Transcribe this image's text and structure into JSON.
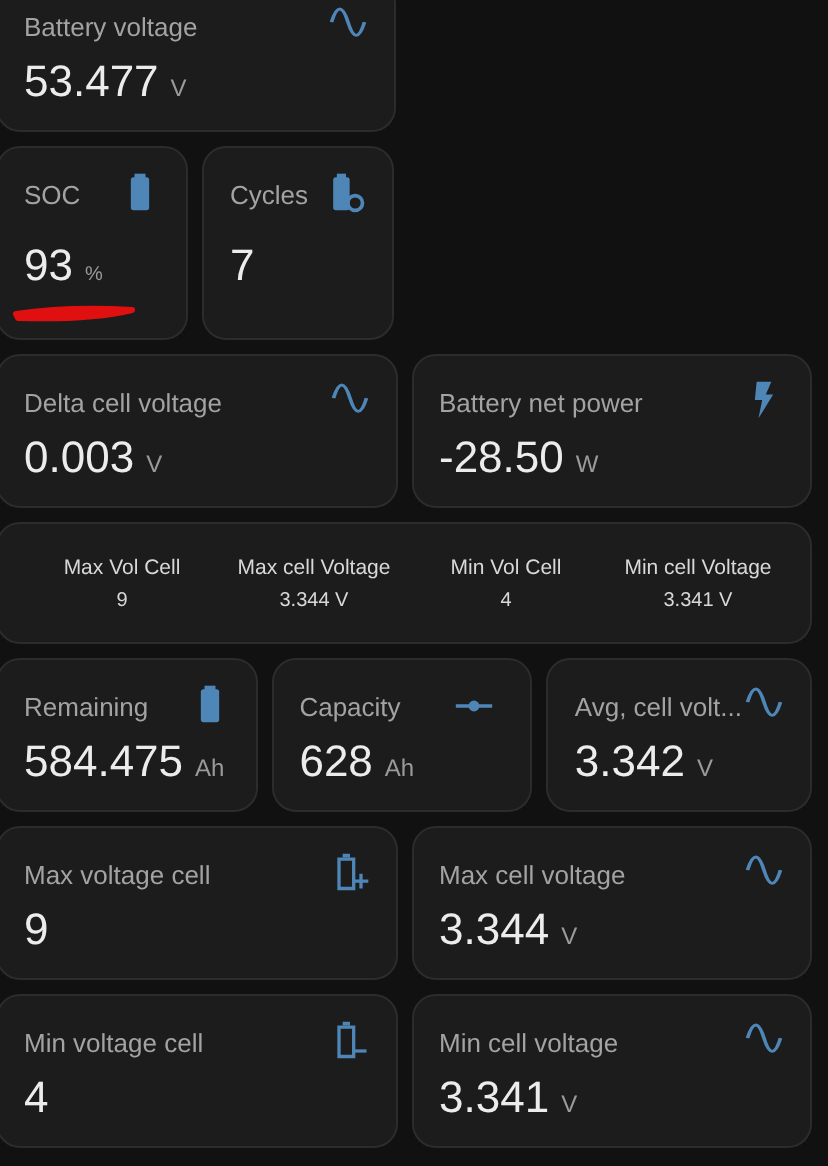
{
  "rows": [
    {
      "kind": "half",
      "cards": [
        {
          "kind": "sine",
          "title": "Battery voltage",
          "value": "53.477",
          "unit": "V"
        }
      ]
    },
    {
      "kind": "quarters",
      "cards": [
        {
          "kind": "battery",
          "title": "SOC",
          "value": "93",
          "unit": "%",
          "underlined": true
        },
        {
          "kind": "battery-sync",
          "title": "Cycles",
          "value": "7",
          "underlined": false
        }
      ]
    },
    {
      "kind": "halves",
      "cards": [
        {
          "kind": "sine",
          "title": "Delta cell voltage",
          "value": "0.003",
          "unit": "V"
        },
        {
          "kind": "flash",
          "title": "Battery net power",
          "value": "-28.50",
          "unit": "W"
        }
      ]
    },
    {
      "kind": "stats",
      "items": [
        {
          "label": "Max Vol Cell",
          "value": "9"
        },
        {
          "label": "Max cell Voltage",
          "value": "3.344 V"
        },
        {
          "label": "Min Vol Cell",
          "value": "4"
        },
        {
          "label": "Min cell Voltage",
          "value": "3.341 V"
        }
      ]
    },
    {
      "kind": "thirds",
      "cards": [
        {
          "kind": "battery",
          "title": "Remaining",
          "value": "584.475",
          "unit": "Ah"
        },
        {
          "kind": "dot-line",
          "title": "Capacity",
          "value": "628",
          "unit": "Ah"
        },
        {
          "kind": "sine",
          "title": "Avg, cell volt...",
          "value": "3.342",
          "unit": "V"
        }
      ]
    },
    {
      "kind": "halves",
      "cards": [
        {
          "kind": "battery-plus",
          "title": "Max voltage cell",
          "value": "9"
        },
        {
          "kind": "sine",
          "title": "Max cell voltage",
          "value": "3.344",
          "unit": "V"
        }
      ]
    },
    {
      "kind": "halves",
      "cards": [
        {
          "kind": "battery-minus",
          "title": "Min voltage cell",
          "value": "4"
        },
        {
          "kind": "sine",
          "title": "Min cell voltage",
          "value": "3.341",
          "unit": "V"
        }
      ]
    }
  ]
}
